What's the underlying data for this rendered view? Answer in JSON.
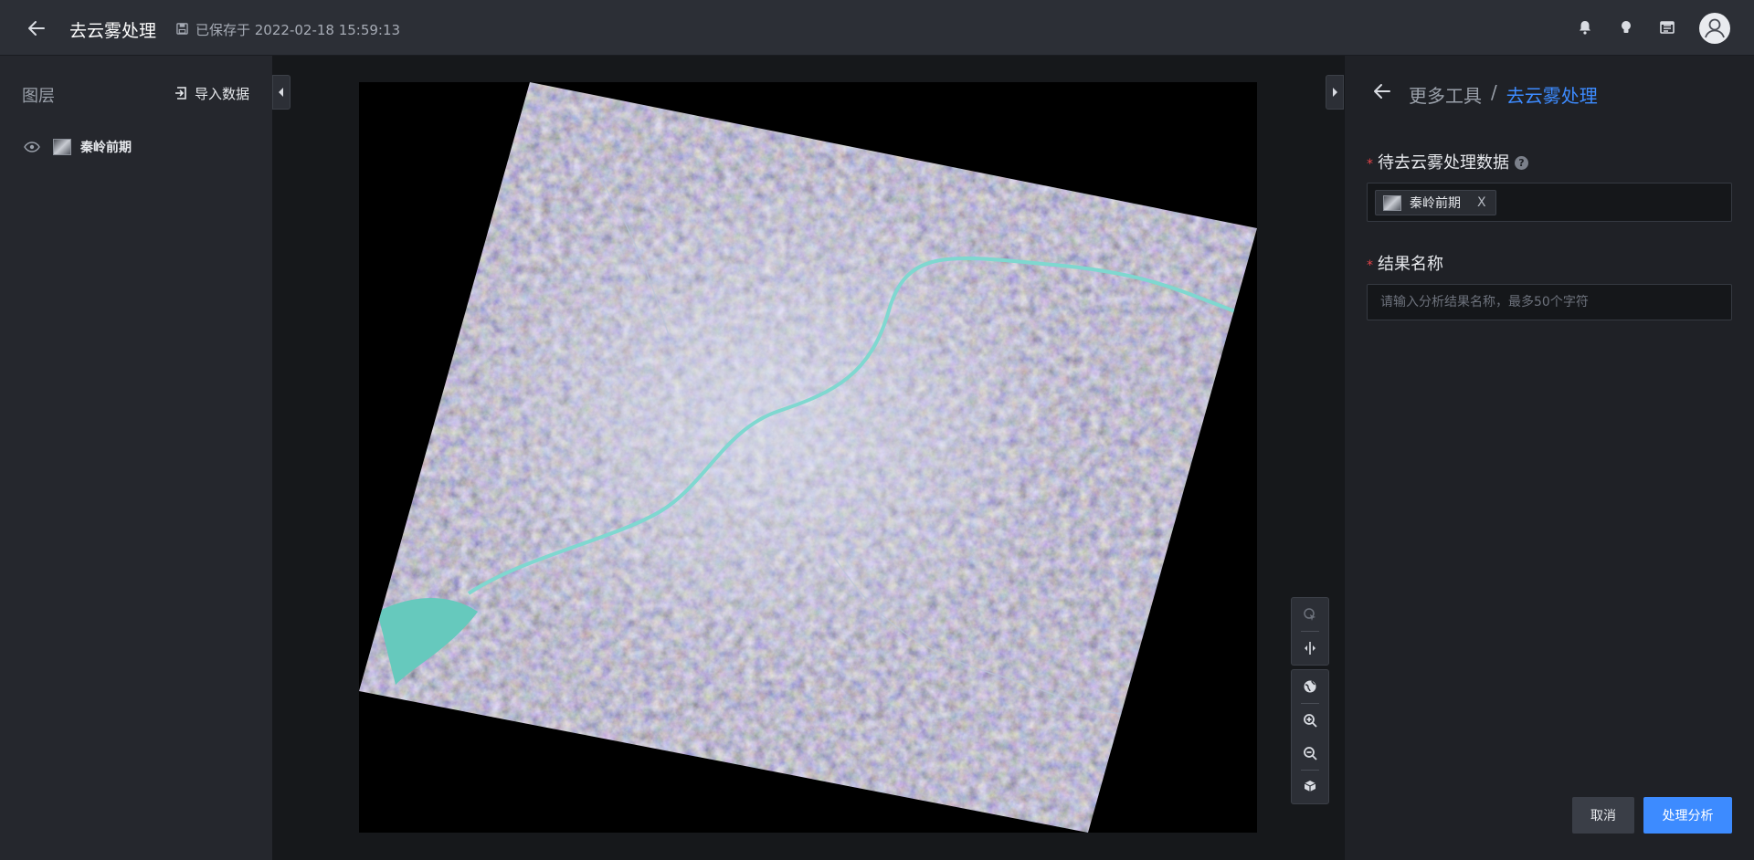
{
  "topbar": {
    "title": "去云雾处理",
    "saved_text": "已保存于 2022-02-18 15:59:13",
    "icons": [
      "back-arrow-icon",
      "save-disk-icon",
      "bell-icon",
      "lightbulb-icon",
      "book-icon",
      "user-avatar-icon"
    ]
  },
  "left_panel": {
    "title": "图层",
    "import_label": "导入数据",
    "layers": [
      {
        "name": "秦岭前期",
        "visible": true
      }
    ]
  },
  "map": {
    "tools": [
      "select-pointer-icon",
      "split-compare-icon",
      "globe-icon",
      "zoom-in-icon",
      "zoom-out-icon",
      "3d-view-icon"
    ]
  },
  "right_panel": {
    "breadcrumb_parent": "更多工具",
    "breadcrumb_sep": "/",
    "breadcrumb_current": "去云雾处理",
    "field1_label": "待去云雾处理数据",
    "field1_required": "*",
    "field1_help": "?",
    "field1_tag": "秦岭前期",
    "field1_tag_close": "X",
    "field2_label": "结果名称",
    "field2_required": "*",
    "field2_placeholder": "请输入分析结果名称，最多50个字符",
    "field2_value": "",
    "cancel_label": "取消",
    "submit_label": "处理分析"
  },
  "colors": {
    "accent": "#3d8bff",
    "required": "#e5454a",
    "topbar_bg": "#2c2f36",
    "panel_bg": "#25272d"
  }
}
